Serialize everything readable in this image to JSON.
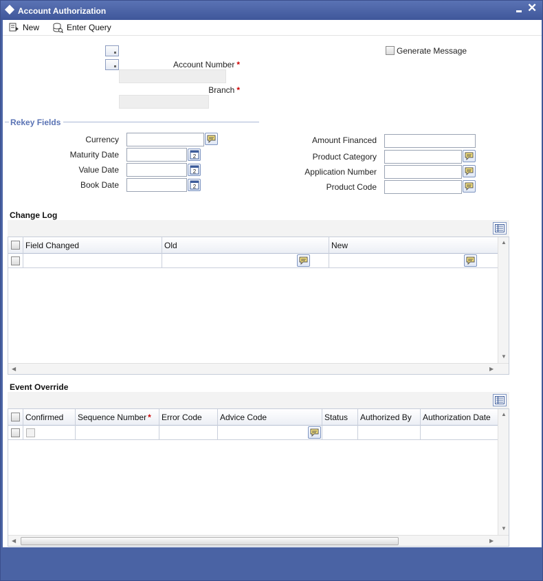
{
  "window": {
    "title": "Account Authorization"
  },
  "toolbar": {
    "new_label": "New",
    "enter_query_label": "Enter Query"
  },
  "header": {
    "account_number_label": "Account Number",
    "branch_label": "Branch",
    "generate_message_label": "Generate Message",
    "required_mark": "*"
  },
  "rekey": {
    "title": "Rekey Fields",
    "currency_label": "Currency",
    "maturity_date_label": "Maturity Date",
    "value_date_label": "Value Date",
    "book_date_label": "Book Date",
    "amount_financed_label": "Amount Financed",
    "product_category_label": "Product Category",
    "application_number_label": "Application Number",
    "product_code_label": "Product Code"
  },
  "change_log": {
    "title": "Change Log",
    "columns": [
      "Field Changed",
      "Old",
      "New"
    ]
  },
  "event_override": {
    "title": "Event Override",
    "columns": [
      "Confirmed",
      "Sequence Number",
      "Error Code",
      "Advice Code",
      "Status",
      "Authorized By",
      "Authorization Date"
    ]
  },
  "icons": {
    "calendar": "calendar-icon",
    "lov": "speech-bubble-icon",
    "grid_settings": "list-view-icon"
  },
  "colors": {
    "titlebar": "#4a63a4",
    "section_title": "#5a73b4",
    "required": "#cc0000"
  }
}
